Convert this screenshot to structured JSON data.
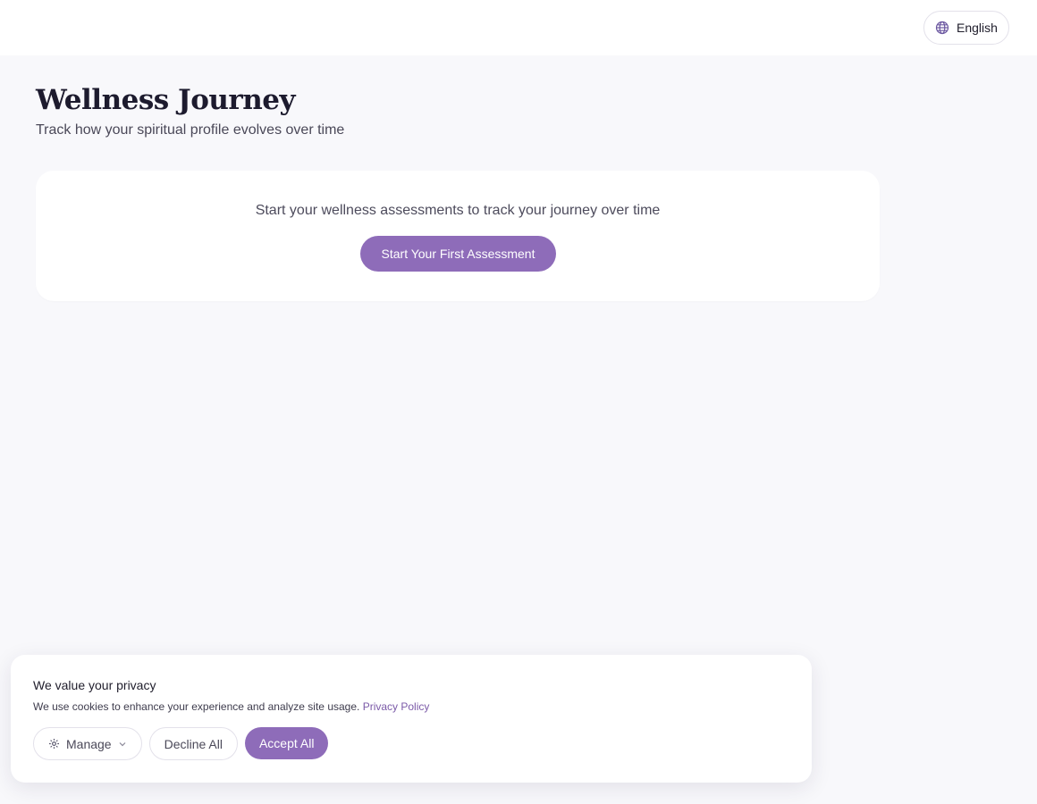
{
  "header": {
    "language_label": "English",
    "language_icon": "globe-icon"
  },
  "main": {
    "title": "Wellness Journey",
    "subtitle": "Track how your spiritual profile evolves over time",
    "empty_state": {
      "message": "Start your wellness assessments to track your journey over time",
      "button_label": "Start Your First Assessment"
    }
  },
  "cookie_banner": {
    "title": "We value your privacy",
    "description": "We use cookies to enhance your experience and analyze site usage.",
    "privacy_link": "Privacy Policy",
    "manage_label": "Manage",
    "manage_icon": "gear-icon",
    "manage_chevron": "chevron-down-icon",
    "decline_label": "Decline All",
    "accept_label": "Accept All"
  },
  "colors": {
    "accent": "#8e6cb9",
    "link": "#7b5aa8",
    "page_background": "#f8f8fb",
    "card_background": "#ffffff"
  }
}
